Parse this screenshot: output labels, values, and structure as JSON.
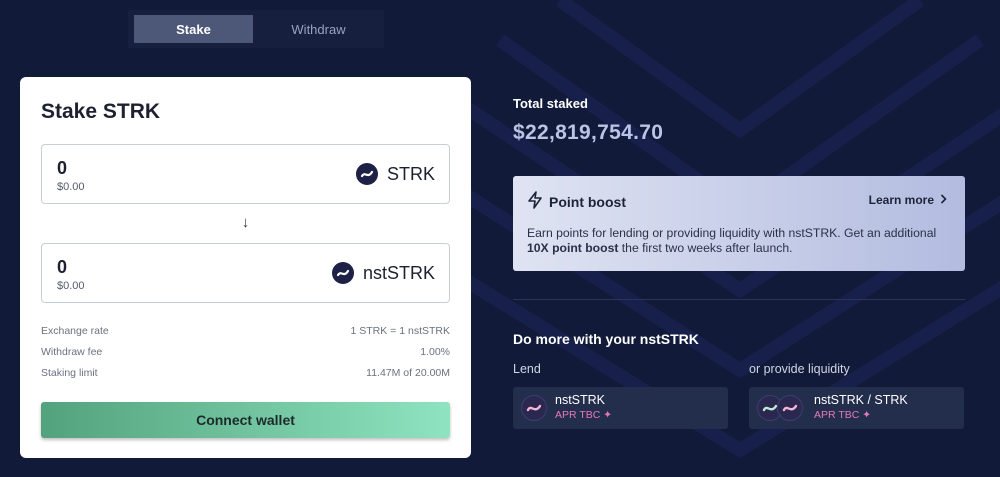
{
  "tabs": [
    {
      "label": "Stake",
      "active": true
    },
    {
      "label": "Withdraw",
      "active": false
    }
  ],
  "stake_card": {
    "title": "Stake STRK",
    "input": {
      "amount": "0",
      "usd": "$0.00",
      "token": "STRK"
    },
    "output": {
      "amount": "0",
      "usd": "$0.00",
      "token": "nstSTRK"
    },
    "arrow": "↓",
    "info": [
      {
        "label": "Exchange rate",
        "value": "1 STRK = 1 nstSTRK"
      },
      {
        "label": "Withdraw fee",
        "value": "1.00%"
      },
      {
        "label": "Staking limit",
        "value": "11.47M of 20.00M"
      }
    ],
    "connect_label": "Connect wallet"
  },
  "summary": {
    "total_label": "Total staked",
    "total_value": "$22,819,754.70"
  },
  "boost": {
    "title": "Point boost",
    "learn_more": "Learn more",
    "text_before": "Earn points for lending or providing liquidity with nstSTRK. Get an additional ",
    "text_bold": "10X point boost",
    "text_after": " the first two weeks after launch."
  },
  "do_more": {
    "title": "Do more with your nstSTRK",
    "lend_label": "Lend",
    "liquidity_label": "or provide liquidity",
    "lend_pool": {
      "name": "nstSTRK",
      "apr": "APR TBC ✦"
    },
    "liquidity_pool": {
      "name": "nstSTRK / STRK",
      "apr": "APR TBC ✦"
    }
  },
  "colors": {
    "background": "#111a38",
    "accent_green_start": "#52a37d",
    "accent_green_end": "#8fe3c0",
    "apr_pink": "#e779b8"
  },
  "icons": [
    "strk-token-icon",
    "nststrk-token-icon",
    "lightning-icon",
    "chevron-right-icon",
    "sparkle-icon"
  ]
}
